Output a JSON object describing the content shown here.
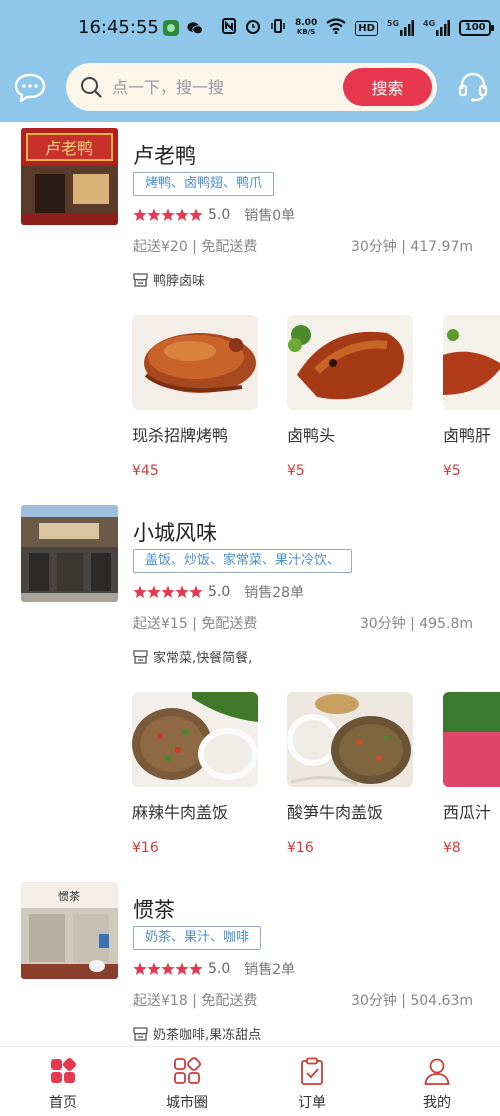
{
  "status_bar": {
    "time": "16:45:55",
    "net_speed_top": "8.00",
    "net_speed_unit": "KB/S",
    "hd_label": "HD",
    "sig1": "5G",
    "sig2": "4G",
    "battery": "100"
  },
  "search": {
    "placeholder": "点一下，搜一搜",
    "button_label": "搜索"
  },
  "colors": {
    "header_bg": "#8ec7ea",
    "accent": "#e8384f",
    "price": "#d43a3a",
    "tag_text": "#4a8fd0"
  },
  "shops": [
    {
      "name": "卢老鸭",
      "tags": "烤鸭、卤鸭翅、鸭爪",
      "rating": "5.0",
      "stars": 5,
      "sales": "销售0单",
      "delivery": "起送¥20 | 免配送费",
      "eta_distance": "30分钟 | 417.97m",
      "feature": "鸭脖卤味",
      "dishes": [
        {
          "name": "现杀招牌烤鸭",
          "price": "¥45"
        },
        {
          "name": "卤鸭头",
          "price": "¥5"
        },
        {
          "name": "卤鸭肝",
          "price": "¥5"
        }
      ]
    },
    {
      "name": "小城风味",
      "tags": "盖饭、炒饭、家常菜、果汁冷饮、",
      "rating": "5.0",
      "stars": 5,
      "sales": "销售28单",
      "delivery": "起送¥15 | 免配送费",
      "eta_distance": "30分钟 | 495.8m",
      "feature": "家常菜,快餐简餐,",
      "dishes": [
        {
          "name": "麻辣牛肉盖饭",
          "price": "¥16"
        },
        {
          "name": "酸笋牛肉盖饭",
          "price": "¥16"
        },
        {
          "name": "西瓜汁",
          "price": "¥8"
        }
      ]
    },
    {
      "name": "惯茶",
      "tags": "奶茶、果汁、咖啡",
      "rating": "5.0",
      "stars": 5,
      "sales": "销售2单",
      "delivery": "起送¥18 | 免配送费",
      "eta_distance": "30分钟 | 504.63m",
      "feature": "奶茶咖啡,果冻甜点"
    }
  ],
  "nav": [
    {
      "label": "首页",
      "icon": "home-grid-icon"
    },
    {
      "label": "城市圈",
      "icon": "city-circle-icon"
    },
    {
      "label": "订单",
      "icon": "order-clipboard-icon"
    },
    {
      "label": "我的",
      "icon": "profile-icon"
    }
  ]
}
